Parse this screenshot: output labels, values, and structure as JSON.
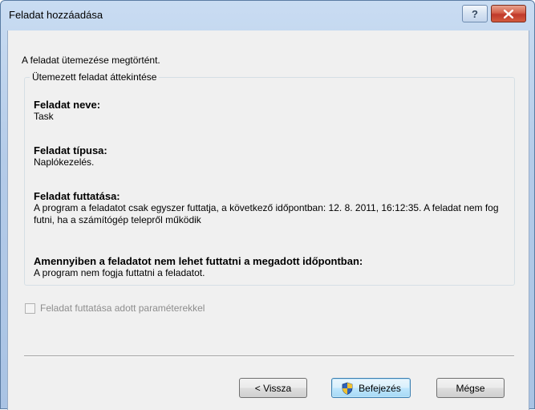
{
  "window": {
    "title": "Feladat hozzáadása"
  },
  "titlebar": {
    "help_label": "?"
  },
  "main": {
    "info": "A feladat ütemezése megtörtént.",
    "group_title": "Ütemezett feladat áttekintése",
    "fields": [
      {
        "label": "Feladat neve:",
        "value": "Task"
      },
      {
        "label": "Feladat típusa:",
        "value": "Naplókezelés."
      },
      {
        "label": "Feladat futtatása:",
        "value": "A program a feladatot csak egyszer futtatja, a következő időpontban: 12. 8. 2011, 16:12:35. A feladat nem fog futni, ha a számítógép telepről működik"
      },
      {
        "label": "Amennyiben a feladatot nem lehet futtatni a megadott időpontban:",
        "value": "A program nem fogja futtatni a feladatot."
      }
    ],
    "checkbox": {
      "label": "Feladat futtatása adott paraméterekkel",
      "checked": false,
      "enabled": false
    }
  },
  "buttons": {
    "back": "< Vissza",
    "finish": "Befejezés",
    "cancel": "Mégse"
  },
  "colors": {
    "titlebar": "#b4cbe8",
    "close_button": "#c0392b",
    "client_bg": "#f0f0f0",
    "finish_border": "#3c7fb1"
  },
  "icons": {
    "help": "help-icon",
    "close": "close-icon",
    "shield": "uac-shield-icon"
  }
}
